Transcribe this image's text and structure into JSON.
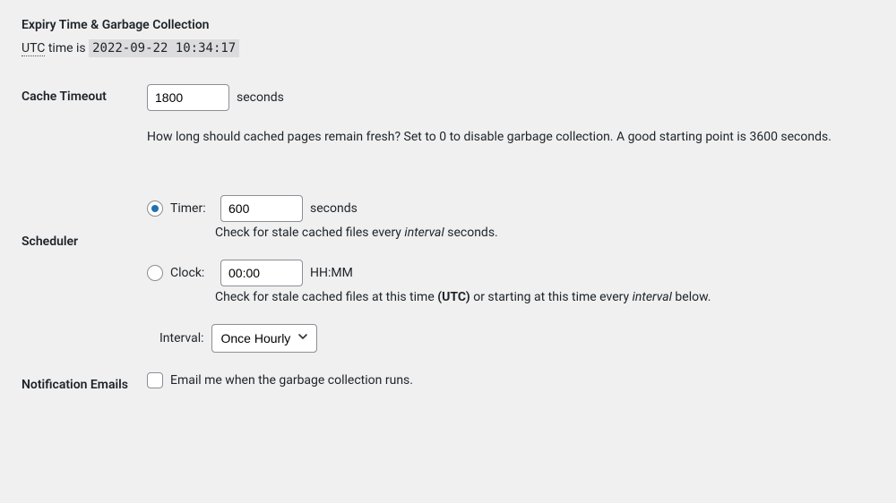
{
  "section_title": "Expiry Time & Garbage Collection",
  "utc": {
    "abbr": "UTC",
    "label_suffix": " time is ",
    "timestamp": "2022-09-22 10:34:17"
  },
  "cache_timeout": {
    "label": "Cache Timeout",
    "value": "1800",
    "unit": "seconds",
    "help": "How long should cached pages remain fresh? Set to 0 to disable garbage collection. A good starting point is 3600 seconds."
  },
  "scheduler": {
    "label": "Scheduler",
    "timer": {
      "option_label": "Timer:",
      "value": "600",
      "unit": "seconds",
      "note_prefix": "Check for stale cached files every ",
      "note_em": "interval",
      "note_suffix": " seconds."
    },
    "clock": {
      "option_label": "Clock:",
      "value": "00:00",
      "format": "HH:MM",
      "note_prefix": "Check for stale cached files at this time ",
      "note_strong": "(UTC)",
      "note_mid": " or starting at this time every ",
      "note_em": "interval",
      "note_suffix": " below."
    },
    "interval": {
      "label": "Interval:",
      "selected": "Once Hourly"
    }
  },
  "notification": {
    "label": "Notification Emails",
    "checkbox_label": "Email me when the garbage collection runs."
  }
}
